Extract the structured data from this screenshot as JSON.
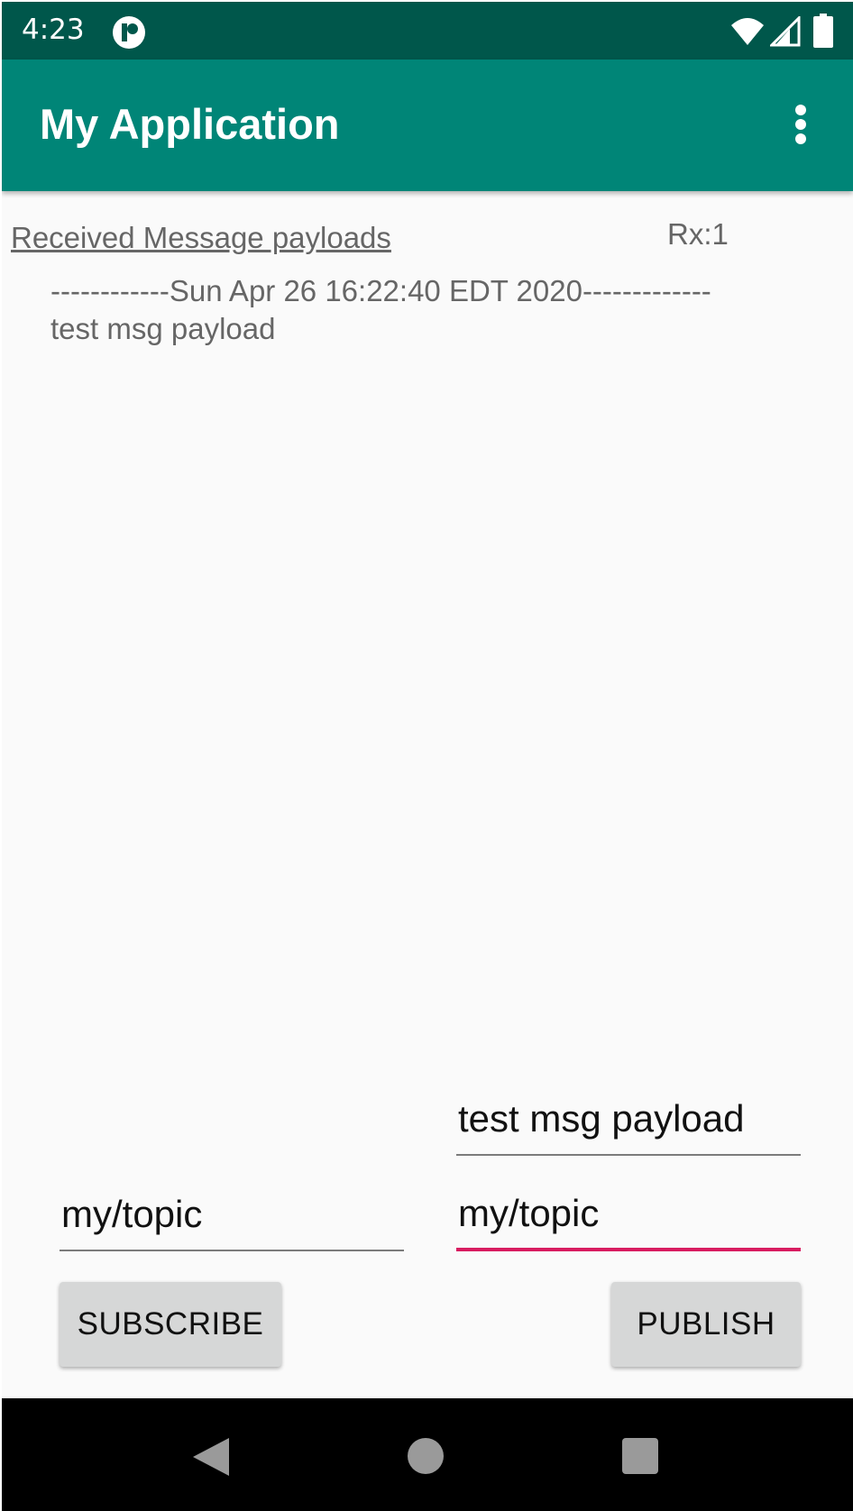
{
  "status_bar": {
    "time": "4:23",
    "icons": [
      "app-notification-icon",
      "wifi-icon",
      "signal-icon",
      "battery-icon"
    ]
  },
  "app_bar": {
    "title": "My Application",
    "menu_icon": "overflow-menu-icon"
  },
  "content": {
    "received_heading": "Received Message payloads",
    "rx_count": "Rx:1",
    "message_log": "------------Sun Apr 26 16:22:40 EDT 2020-------------\ntest msg payload"
  },
  "form": {
    "payload_value": "test msg payload",
    "subscribe_topic_value": "my/topic",
    "publish_topic_value": "my/topic",
    "subscribe_label": "SUBSCRIBE",
    "publish_label": "PUBLISH"
  },
  "nav_bar": {
    "buttons": [
      "back-icon",
      "home-icon",
      "recents-icon"
    ]
  },
  "colors": {
    "status_bar": "#00574b",
    "app_bar": "#008577",
    "accent": "#d81b60",
    "background": "#fafafa"
  }
}
